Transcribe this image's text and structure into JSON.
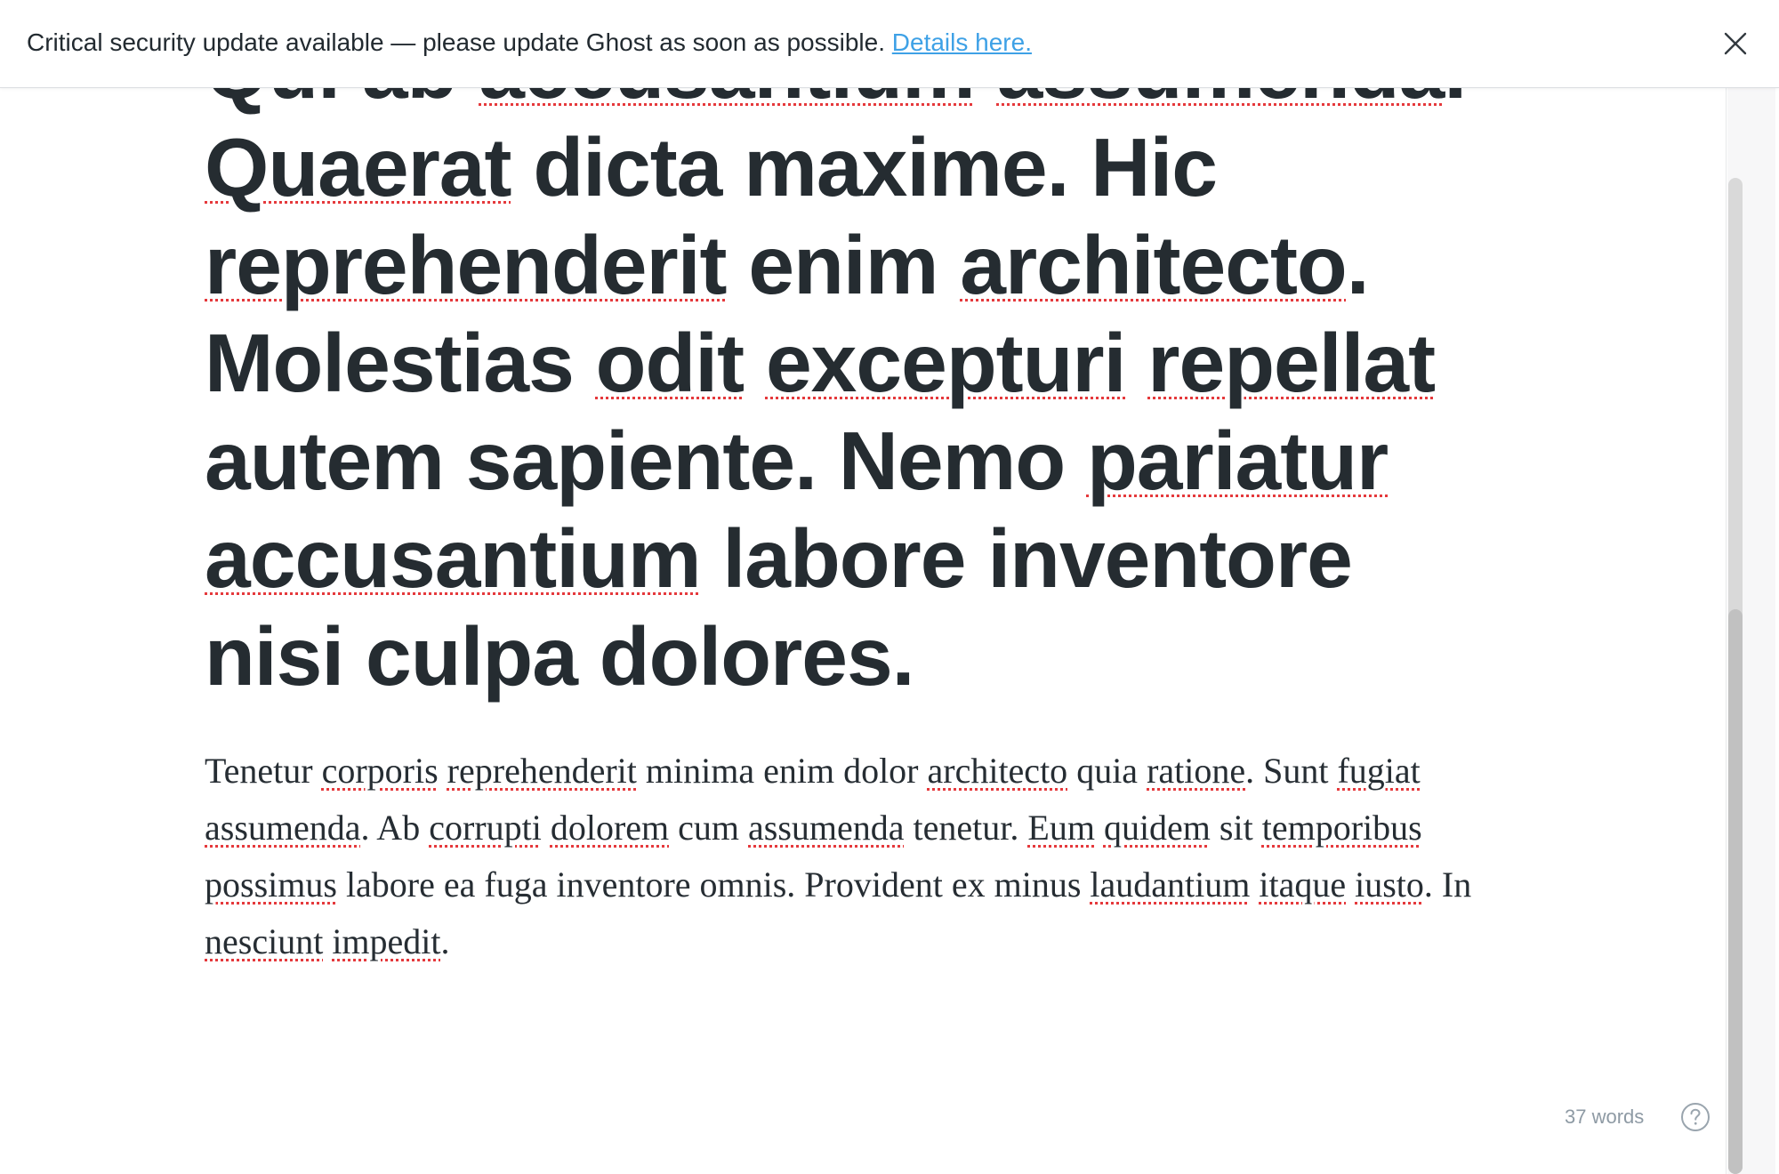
{
  "banner": {
    "message": "Critical security update available — please update Ghost as soon as possible.",
    "link_label": "Details here.",
    "close_icon": "close-icon"
  },
  "post": {
    "title_segments": [
      {
        "t": "Qui ab ",
        "s": false
      },
      {
        "t": "accusantium",
        "s": true
      },
      {
        "t": " ",
        "s": false
      },
      {
        "t": "assumenda",
        "s": true
      },
      {
        "t": ". ",
        "s": false
      },
      {
        "t": "Quaerat",
        "s": true
      },
      {
        "t": " dicta maxime. Hic ",
        "s": false
      },
      {
        "t": "reprehenderit",
        "s": true
      },
      {
        "t": " enim ",
        "s": false
      },
      {
        "t": "architecto",
        "s": true
      },
      {
        "t": ". Molestias ",
        "s": false
      },
      {
        "t": "odit",
        "s": true
      },
      {
        "t": " ",
        "s": false
      },
      {
        "t": "excepturi",
        "s": true
      },
      {
        "t": " ",
        "s": false
      },
      {
        "t": "repellat",
        "s": true
      },
      {
        "t": " autem sapiente. Nemo ",
        "s": false
      },
      {
        "t": "pariatur",
        "s": true
      },
      {
        "t": " ",
        "s": false
      },
      {
        "t": "accusantium",
        "s": true
      },
      {
        "t": " labore inventore nisi culpa dolores.",
        "s": false
      }
    ],
    "body_segments": [
      {
        "t": "Tenetur ",
        "s": false
      },
      {
        "t": "corporis",
        "s": true
      },
      {
        "t": " ",
        "s": false
      },
      {
        "t": "reprehenderit",
        "s": true
      },
      {
        "t": " minima enim dolor ",
        "s": false
      },
      {
        "t": "architecto",
        "s": true
      },
      {
        "t": " quia ",
        "s": false
      },
      {
        "t": "ratione",
        "s": true
      },
      {
        "t": ". Sunt ",
        "s": false
      },
      {
        "t": "fugiat",
        "s": true
      },
      {
        "t": " ",
        "s": false
      },
      {
        "t": "assumenda",
        "s": true
      },
      {
        "t": ". Ab ",
        "s": false
      },
      {
        "t": "corrupti",
        "s": true
      },
      {
        "t": " ",
        "s": false
      },
      {
        "t": "dolorem",
        "s": true
      },
      {
        "t": " cum ",
        "s": false
      },
      {
        "t": "assumenda",
        "s": true
      },
      {
        "t": " tenetur. ",
        "s": false
      },
      {
        "t": "Eum",
        "s": true
      },
      {
        "t": " ",
        "s": false
      },
      {
        "t": "quidem",
        "s": true
      },
      {
        "t": " sit ",
        "s": false
      },
      {
        "t": "temporibus",
        "s": true
      },
      {
        "t": " ",
        "s": false
      },
      {
        "t": "possimus",
        "s": true
      },
      {
        "t": " labore ea fuga inventore omnis. Provident ex minus ",
        "s": false
      },
      {
        "t": "laudantium",
        "s": true
      },
      {
        "t": " ",
        "s": false
      },
      {
        "t": "itaque",
        "s": true
      },
      {
        "t": " ",
        "s": false
      },
      {
        "t": "iusto",
        "s": true
      },
      {
        "t": ". In ",
        "s": false
      },
      {
        "t": "nesciunt",
        "s": true
      },
      {
        "t": " ",
        "s": false
      },
      {
        "t": "impedit",
        "s": true
      },
      {
        "t": ".",
        "s": false
      }
    ]
  },
  "status": {
    "word_count": "37 words",
    "help_icon": "help-icon"
  },
  "colors": {
    "link": "#3ea1e6",
    "spellcheck_underline": "#e5393c",
    "text": "#252c31",
    "muted": "#8e9aa4"
  }
}
